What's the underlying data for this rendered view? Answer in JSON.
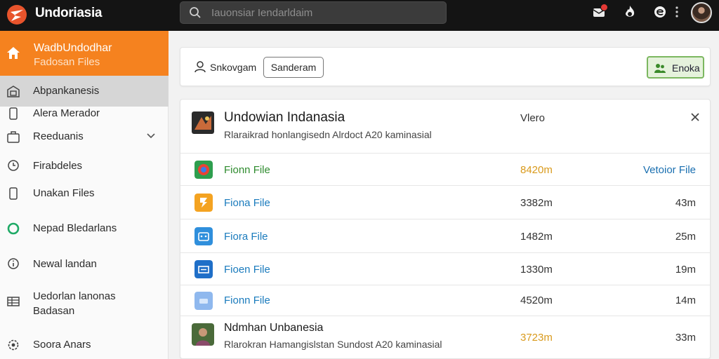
{
  "app": {
    "name": "Undoriasia"
  },
  "search": {
    "placeholder": "Iauonsiar Iendarldaim"
  },
  "topbar": {
    "icons": [
      "logo-icon",
      "search-icon",
      "notification-icon",
      "fire-icon",
      "e-icon",
      "menu-dots-icon",
      "avatar"
    ]
  },
  "sidebar": {
    "hero": {
      "title": "WadbUndodhar",
      "subtitle": "Fadosan Files"
    },
    "items": [
      {
        "label": "Abpankanesis",
        "icon": "building-icon",
        "active": true
      },
      {
        "label": "Alera Merador",
        "icon": "phone-icon"
      },
      {
        "label": "Reeduanis",
        "icon": "briefcase-icon",
        "chevron": "chevron-down-icon"
      },
      {
        "label": "Firabdeles",
        "icon": "clock-icon"
      },
      {
        "label": "Unakan Files",
        "icon": "file-icon"
      },
      {
        "label": "Nepad Bledarlans",
        "icon": "green-circle-icon"
      },
      {
        "label": "Newal landan",
        "icon": "info-icon"
      },
      {
        "label": "Uedorlan lanonas",
        "label2": "Badasan",
        "icon": "grid-icon"
      },
      {
        "label": "Soora Anars",
        "icon": "settings-icon"
      }
    ]
  },
  "toolbar": {
    "user_label": "Snkovgam",
    "outline_button": "Sanderam",
    "green_button": "Enoka"
  },
  "list": {
    "header": {
      "title": "Undowian Indanasia",
      "subtitle": "Rlaraikrad honlangisedn Alrdoct A20 kaminasial",
      "meta": "Vlero"
    },
    "rows": [
      {
        "name": "Fionn File",
        "size": "8420m",
        "extra": "Vetoior File",
        "extra_link": true,
        "icon": "chrome-icon",
        "name_color": "#2e8b2e",
        "size_color": "#e0a020"
      },
      {
        "name": "Fiona File",
        "size": "3382m",
        "extra": "43m",
        "icon": "orange-doc-icon"
      },
      {
        "name": "Fiora File",
        "size": "1482m",
        "extra": "25m",
        "icon": "blue-app-icon"
      },
      {
        "name": "Fioen File",
        "size": "1330m",
        "extra": "19m",
        "icon": "blue-frame-icon"
      },
      {
        "name": "Fionn File",
        "size": "4520m",
        "extra": "14m",
        "icon": "light-blue-icon"
      }
    ],
    "footer": {
      "title": "Ndmhan Unbanesia",
      "subtitle": "Rlarokran Hamangislstan Sundost A20 kaminasial",
      "size": "3723m",
      "extra": "33m",
      "size_color": "#e0a020"
    }
  },
  "colors": {
    "accent": "#f5821f",
    "topbar": "#141414",
    "green": "#7cb760",
    "link": "#1a7bbd"
  }
}
